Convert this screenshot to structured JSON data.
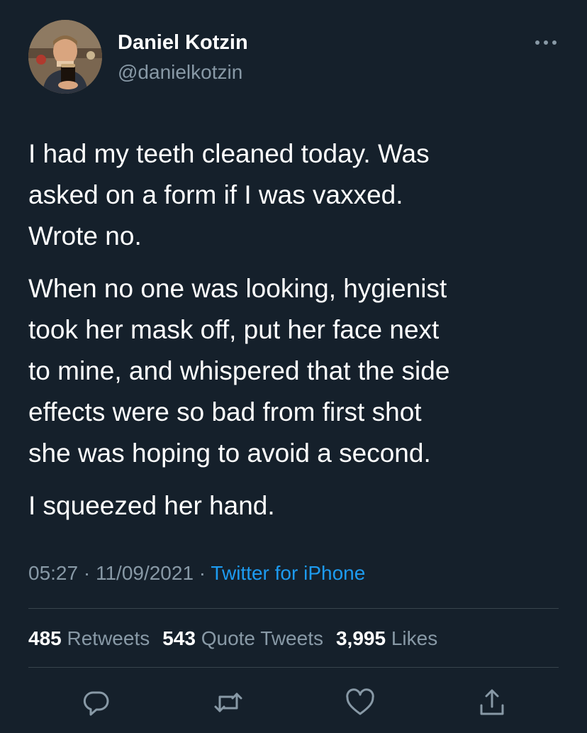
{
  "author": {
    "name": "Daniel Kotzin",
    "handle": "@danielkotzin"
  },
  "tweet": {
    "paragraphs": [
      "I had my teeth cleaned today. Was\nasked on a form if I was vaxxed.\nWrote no.",
      "When no one was looking, hygienist\ntook her mask off, put her face next\nto mine, and whispered that the side\neffects were so bad from first shot\nshe was hoping to avoid a second.",
      "I squeezed her hand."
    ],
    "time": "05:27",
    "date": "11/09/2021",
    "separator": " · ",
    "source": "Twitter for iPhone"
  },
  "stats": {
    "retweets_count": "485",
    "retweets_label": "Retweets",
    "quotes_count": "543",
    "quotes_label": "Quote Tweets",
    "likes_count": "3,995",
    "likes_label": "Likes"
  },
  "icons": {
    "more": "more-horizontal-icon",
    "reply": "reply-icon",
    "retweet": "retweet-icon",
    "like": "heart-icon",
    "share": "share-icon"
  },
  "colors": {
    "background": "#15202b",
    "primary_text": "#ffffff",
    "secondary_text": "#8899a6",
    "link": "#1d9bf0",
    "divider": "#38444d"
  }
}
